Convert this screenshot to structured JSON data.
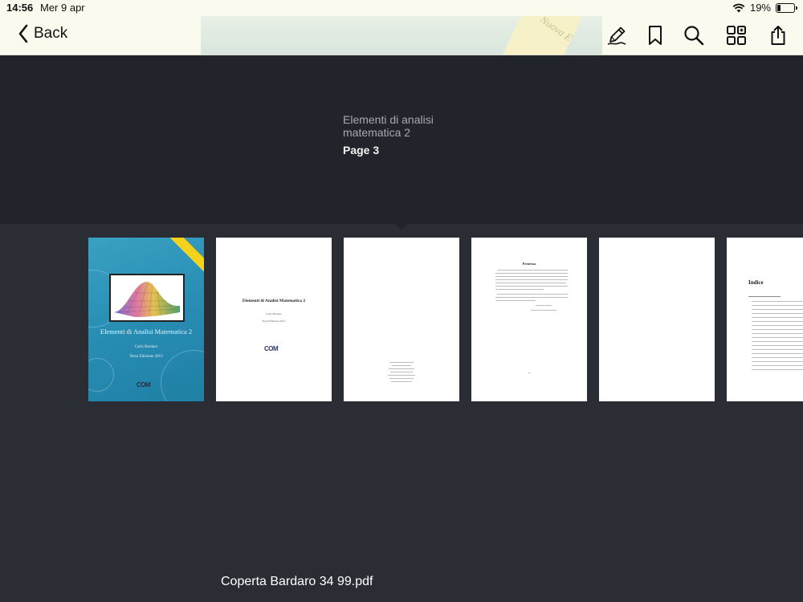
{
  "status_bar": {
    "time": "14:56",
    "date": "Mer 9 apr",
    "battery": "19%",
    "battery_level": 0.19
  },
  "toolbar": {
    "back_label": "Back",
    "icons": [
      "annotate-pencil-icon",
      "bookmark-icon",
      "search-icon",
      "thumbnails-grid-icon",
      "share-icon"
    ],
    "cover_peek_text": "Nuova E"
  },
  "header": {
    "doc_title": "Elementi di analisi matematica 2",
    "page_label": "Page 3"
  },
  "thumbnails": {
    "cover": {
      "title": "Elementi di Analisi Matematica 2",
      "author": "Carlo Bardaro",
      "edition": "Terza Edizione 2013",
      "logo": "COM"
    },
    "page2": {
      "title": "Elementi di Analisi Matematica 2",
      "author": "Carlo Bardaro",
      "edition": "Terza Edizione 2013",
      "logo": "COM"
    },
    "page4": {
      "heading": "Premessa"
    },
    "page6": {
      "heading": "Indice"
    }
  },
  "footer": {
    "file_name": "Coperta Bardaro 34 99.pdf"
  },
  "colors": {
    "toolbar_bg": "#fbfaee",
    "header_bg": "#21242b",
    "body_bg": "#2a2d33",
    "cover_blue": "#2a8fb5"
  }
}
